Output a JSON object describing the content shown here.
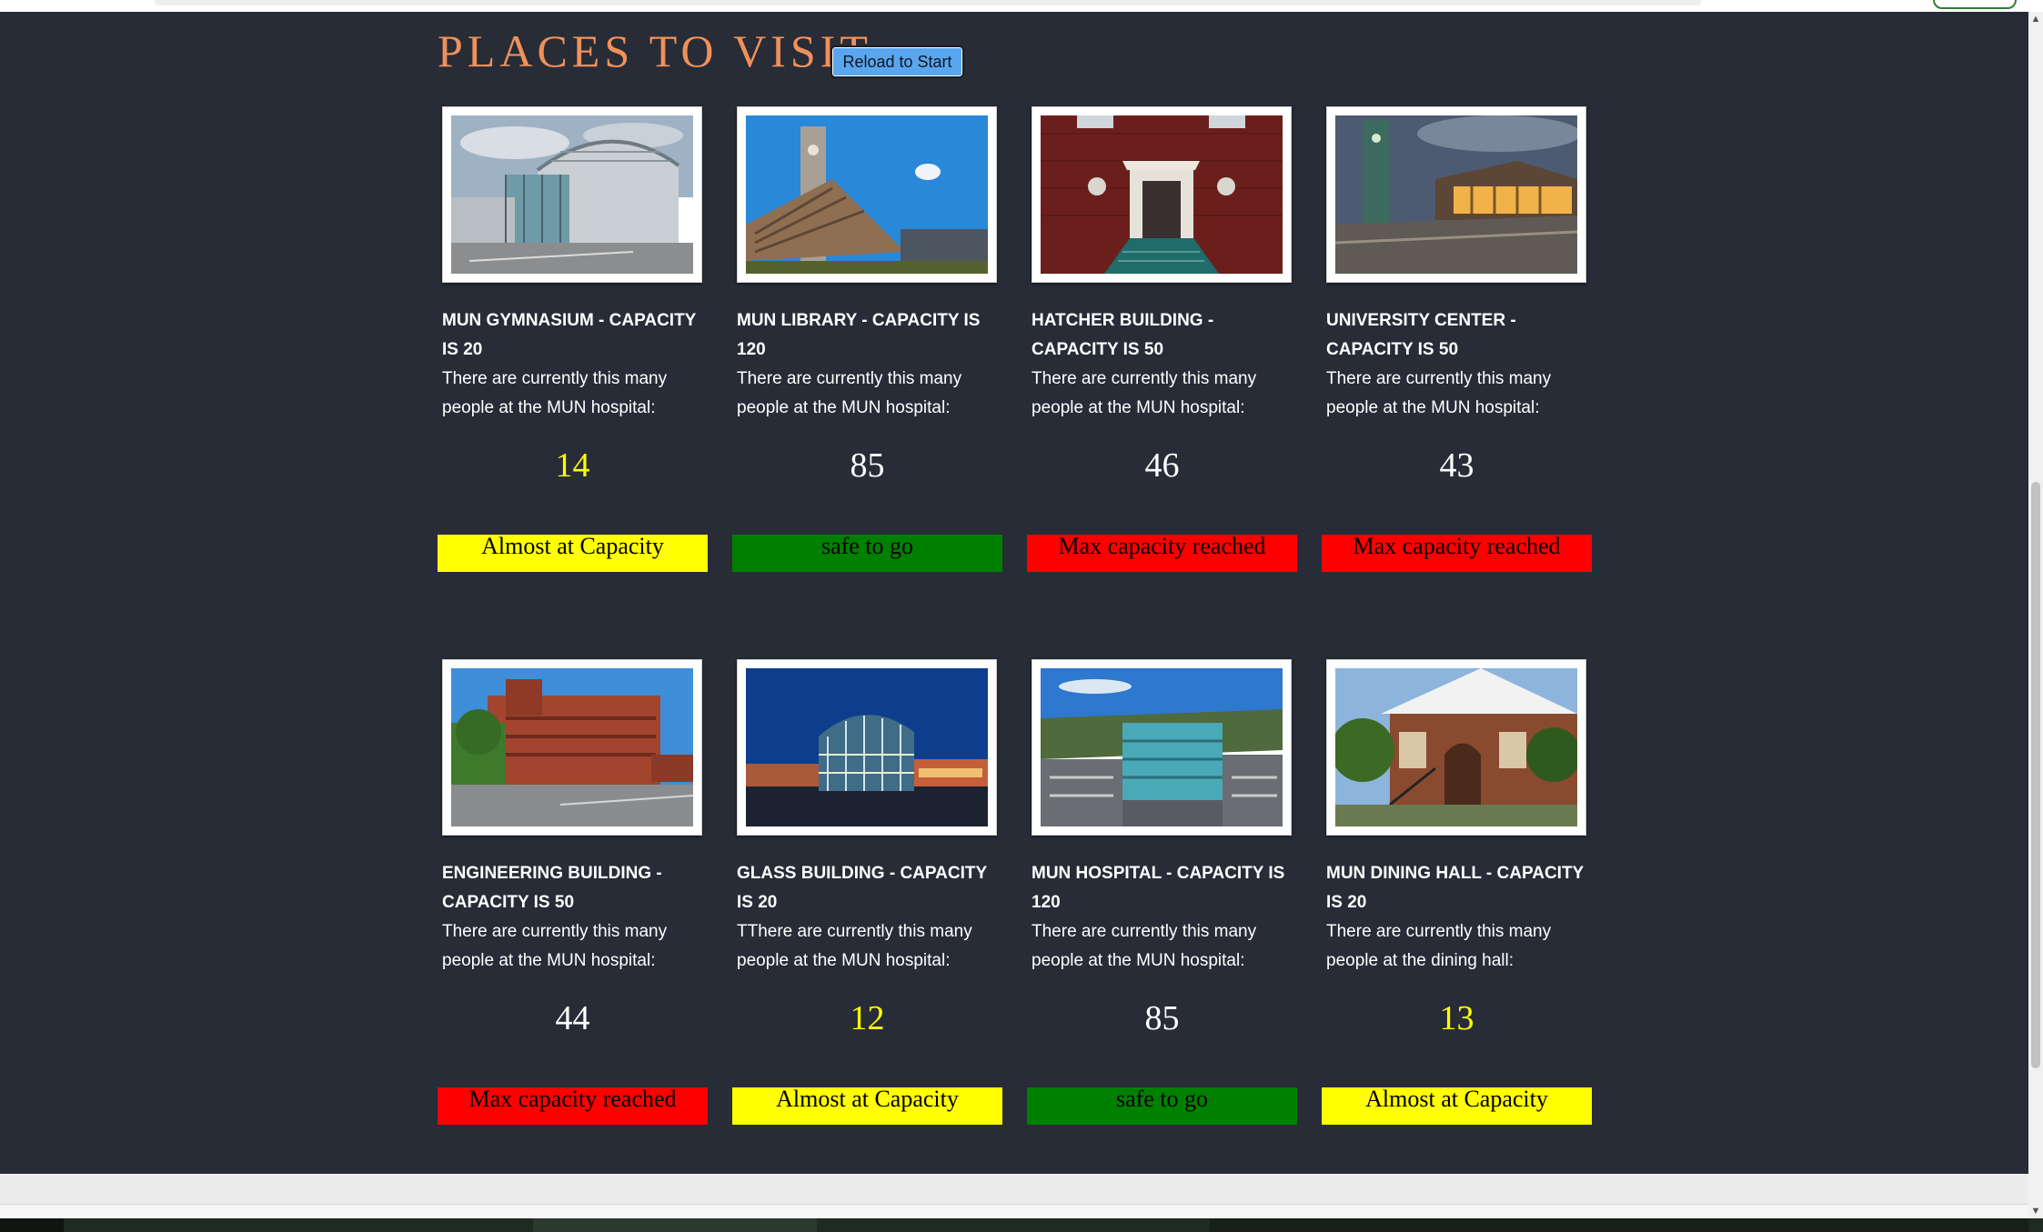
{
  "page": {
    "title": "PLACES TO VISIT",
    "reload_label": "Reload to Start"
  },
  "places": [
    {
      "title": "MUN GYMNASIUM - CAPACITY IS 20",
      "description": "There are currently this many people at the MUN hospital:",
      "count": "14",
      "count_color": "#ffff00",
      "status": "Almost at Capacity",
      "status_color": "#ffff00",
      "image": "gymnasium-photo"
    },
    {
      "title": "MUN LIBRARY - CAPACITY IS 120",
      "description": "There are currently this many people at the MUN hospital:",
      "count": "85",
      "count_color": "#ffffff",
      "status": "safe to go",
      "status_color": "#008000",
      "image": "library-photo"
    },
    {
      "title": "HATCHER BUILDING - CAPACITY IS 50",
      "description": "There are currently this many people at the MUN hospital:",
      "count": "46",
      "count_color": "#ffffff",
      "status": "Max capacity reached",
      "status_color": "#ff0000",
      "image": "hatcher-building-photo"
    },
    {
      "title": "UNIVERSITY CENTER - CAPACITY IS 50",
      "description": "There are currently this many people at the MUN hospital:",
      "count": "43",
      "count_color": "#ffffff",
      "status": "Max capacity reached",
      "status_color": "#ff0000",
      "image": "university-center-photo"
    },
    {
      "title": "ENGINEERING BUILDING - CAPACITY IS 50",
      "description": "There are currently this many people at the MUN hospital:",
      "count": "44",
      "count_color": "#ffffff",
      "status": "Max capacity reached",
      "status_color": "#ff0000",
      "image": "engineering-building-photo"
    },
    {
      "title": "GLASS BUILDING - CAPACITY IS 20",
      "description": "TThere are currently this many people at the MUN hospital:",
      "count": "12",
      "count_color": "#ffff00",
      "status": "Almost at Capacity",
      "status_color": "#ffff00",
      "image": "glass-building-photo"
    },
    {
      "title": "MUN HOSPITAL - CAPACITY IS 120",
      "description": "There are currently this many people at the MUN hospital:",
      "count": "85",
      "count_color": "#ffffff",
      "status": "safe to go",
      "status_color": "#008000",
      "image": "hospital-photo"
    },
    {
      "title": "MUN DINING HALL - CAPACITY IS 20",
      "description": "There are currently this many people at the dining hall:",
      "count": "13",
      "count_color": "#ffff00",
      "status": "Almost at Capacity",
      "status_color": "#ffff00",
      "image": "dining-hall-photo"
    }
  ],
  "colors": {
    "background": "#272c37",
    "title": "#f0915a",
    "button": "#5aa6ee"
  }
}
